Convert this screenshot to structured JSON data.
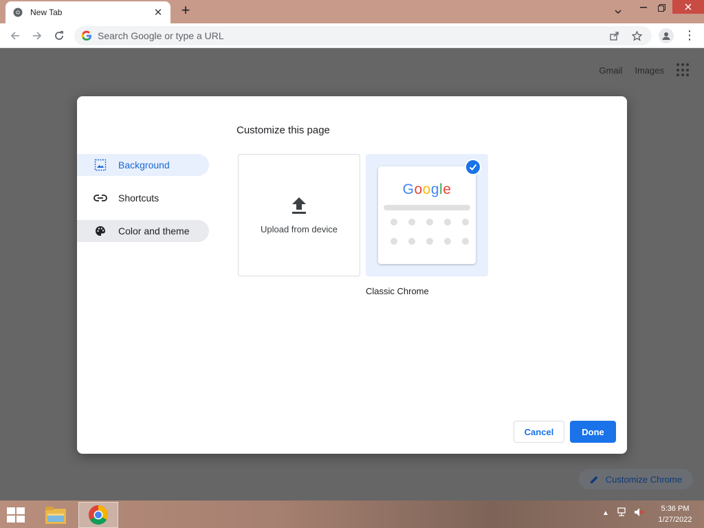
{
  "browser": {
    "tab_title": "New Tab",
    "new_tab_symbol": "+",
    "omnibox_placeholder": "Search Google or type a URL"
  },
  "ntp": {
    "links": [
      "Gmail",
      "Images"
    ],
    "customize_chip_label": "Customize Chrome"
  },
  "dialog": {
    "title": "Customize this page",
    "sidebar": [
      {
        "label": "Background",
        "icon": "image-icon",
        "selected": true
      },
      {
        "label": "Shortcuts",
        "icon": "link-icon"
      },
      {
        "label": "Color and theme",
        "icon": "palette-icon"
      }
    ],
    "tiles": {
      "upload_label": "Upload from device",
      "classic_logo": "Google",
      "classic_label": "Classic Chrome",
      "classic_selected": true
    },
    "buttons": {
      "cancel": "Cancel",
      "done": "Done"
    }
  },
  "taskbar": {
    "time": "5:36 PM",
    "date": "1/27/2022"
  },
  "colors": {
    "accent": "#1a73e8",
    "selected_bg": "#e8f0fe",
    "window_close": "#c84b44",
    "titlebar": "#c89a8a",
    "overlay": "#666666"
  }
}
